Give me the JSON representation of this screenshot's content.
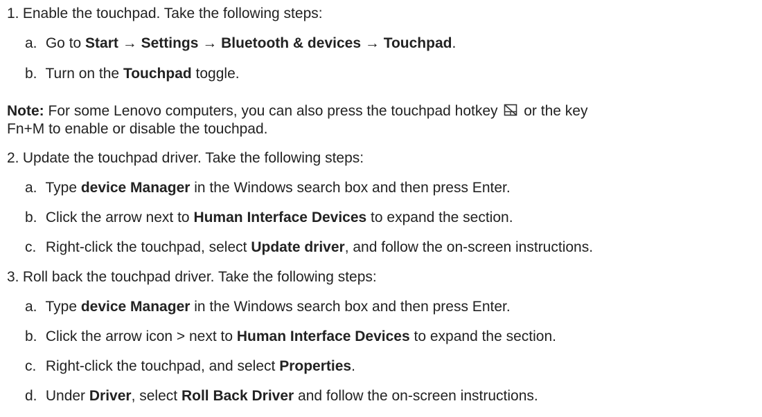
{
  "steps": [
    {
      "number": "1.",
      "text": "Enable the touchpad. Take the following steps:",
      "substeps": [
        {
          "letter": "a.",
          "pre": "Go to ",
          "b1": "Start",
          "arrow1": "→",
          "b2": "Settings",
          "arrow2": "→",
          "b3": "Bluetooth & devices",
          "arrow3": "→",
          "b4": "Touchpad",
          "post": "."
        },
        {
          "letter": "b.",
          "pre": "Turn on the ",
          "bold": "Touchpad",
          "post": " toggle."
        }
      ],
      "note": {
        "label": "Note:",
        "text1": "For some Lenovo computers, you can also press the touchpad hotkey",
        "text2": "or the key",
        "text3": "Fn+M to enable or disable the touchpad."
      }
    },
    {
      "number": "2.",
      "text": "Update the touchpad driver. Take the following steps:",
      "substeps": [
        {
          "letter": "a.",
          "pre": "Type ",
          "bold": "device Manager",
          "post": " in the Windows search box and then press Enter."
        },
        {
          "letter": "b.",
          "pre": "Click the arrow next to ",
          "bold": "Human Interface Devices",
          "post": " to expand the section."
        },
        {
          "letter": "c.",
          "pre": "Right-click the touchpad, select ",
          "bold": "Update driver",
          "post": ", and follow the on-screen instructions."
        }
      ]
    },
    {
      "number": "3.",
      "text": "Roll back the touchpad driver. Take the following steps:",
      "substeps": [
        {
          "letter": "a.",
          "pre": "Type ",
          "bold": "device Manager",
          "post": " in the Windows search box and then press Enter."
        },
        {
          "letter": "b.",
          "pre": "Click the arrow icon > next to ",
          "bold": "Human Interface Devices",
          "post": " to expand the section."
        },
        {
          "letter": "c.",
          "pre": "Right-click the touchpad, and select ",
          "bold": "Properties",
          "post": "."
        },
        {
          "letter": "d.",
          "pre": "Under ",
          "bold": "Driver",
          "mid": ", select ",
          "bold2": "Roll Back Driver",
          "post": " and follow the on-screen instructions."
        }
      ]
    }
  ],
  "icons": {
    "hotkey": "touchpad-disable-icon"
  }
}
